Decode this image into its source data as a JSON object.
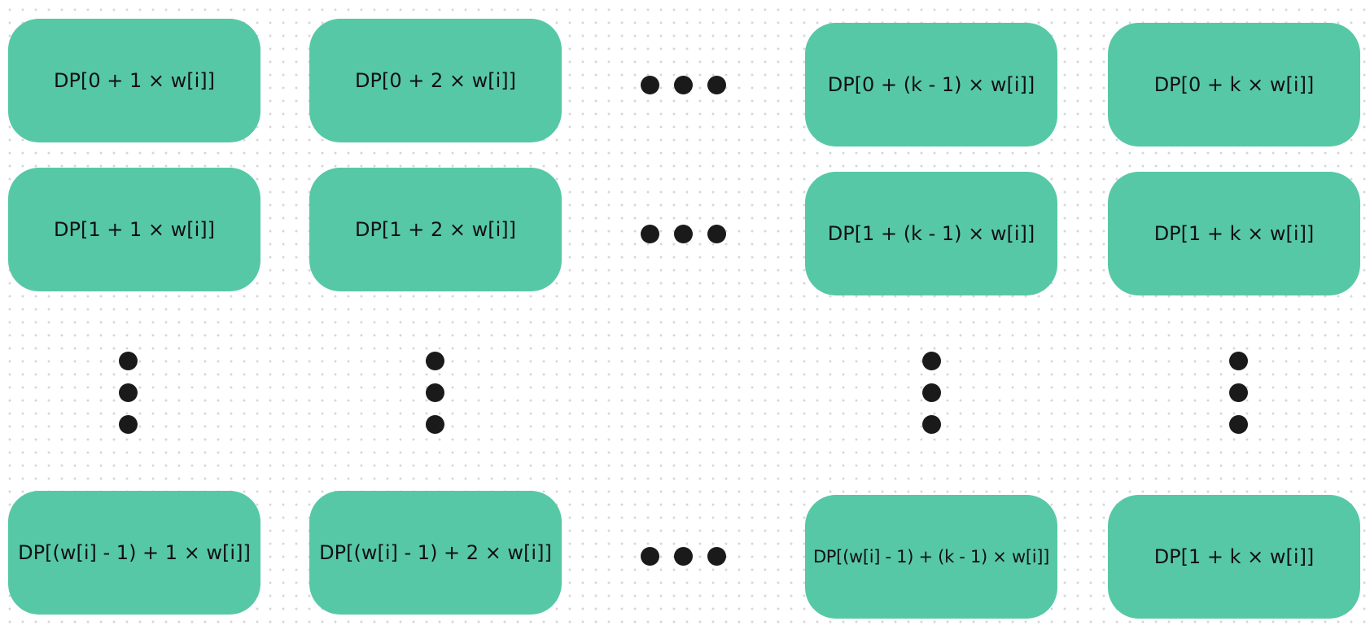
{
  "colors": {
    "cell_fill": "#56c8a6",
    "dot": "#1a1a1a"
  },
  "cells": {
    "r0c0": "DP[0 + 1 × w[i]]",
    "r0c1": "DP[0 + 2 × w[i]]",
    "r0c3": "DP[0 + (k - 1) × w[i]]",
    "r0c4": "DP[0 + k × w[i]]",
    "r1c0": "DP[1 + 1 × w[i]]",
    "r1c1": "DP[1 + 2 × w[i]]",
    "r1c3": "DP[1 + (k - 1) × w[i]]",
    "r1c4": "DP[1 + k × w[i]]",
    "r2c0": "DP[(w[i] - 1) + 1 × w[i]]",
    "r2c1": "DP[(w[i] - 1) + 2 × w[i]]",
    "r2c3": "DP[(w[i] - 1) + (k - 1) × w[i]]",
    "r2c4": "DP[1 + k × w[i]]"
  }
}
